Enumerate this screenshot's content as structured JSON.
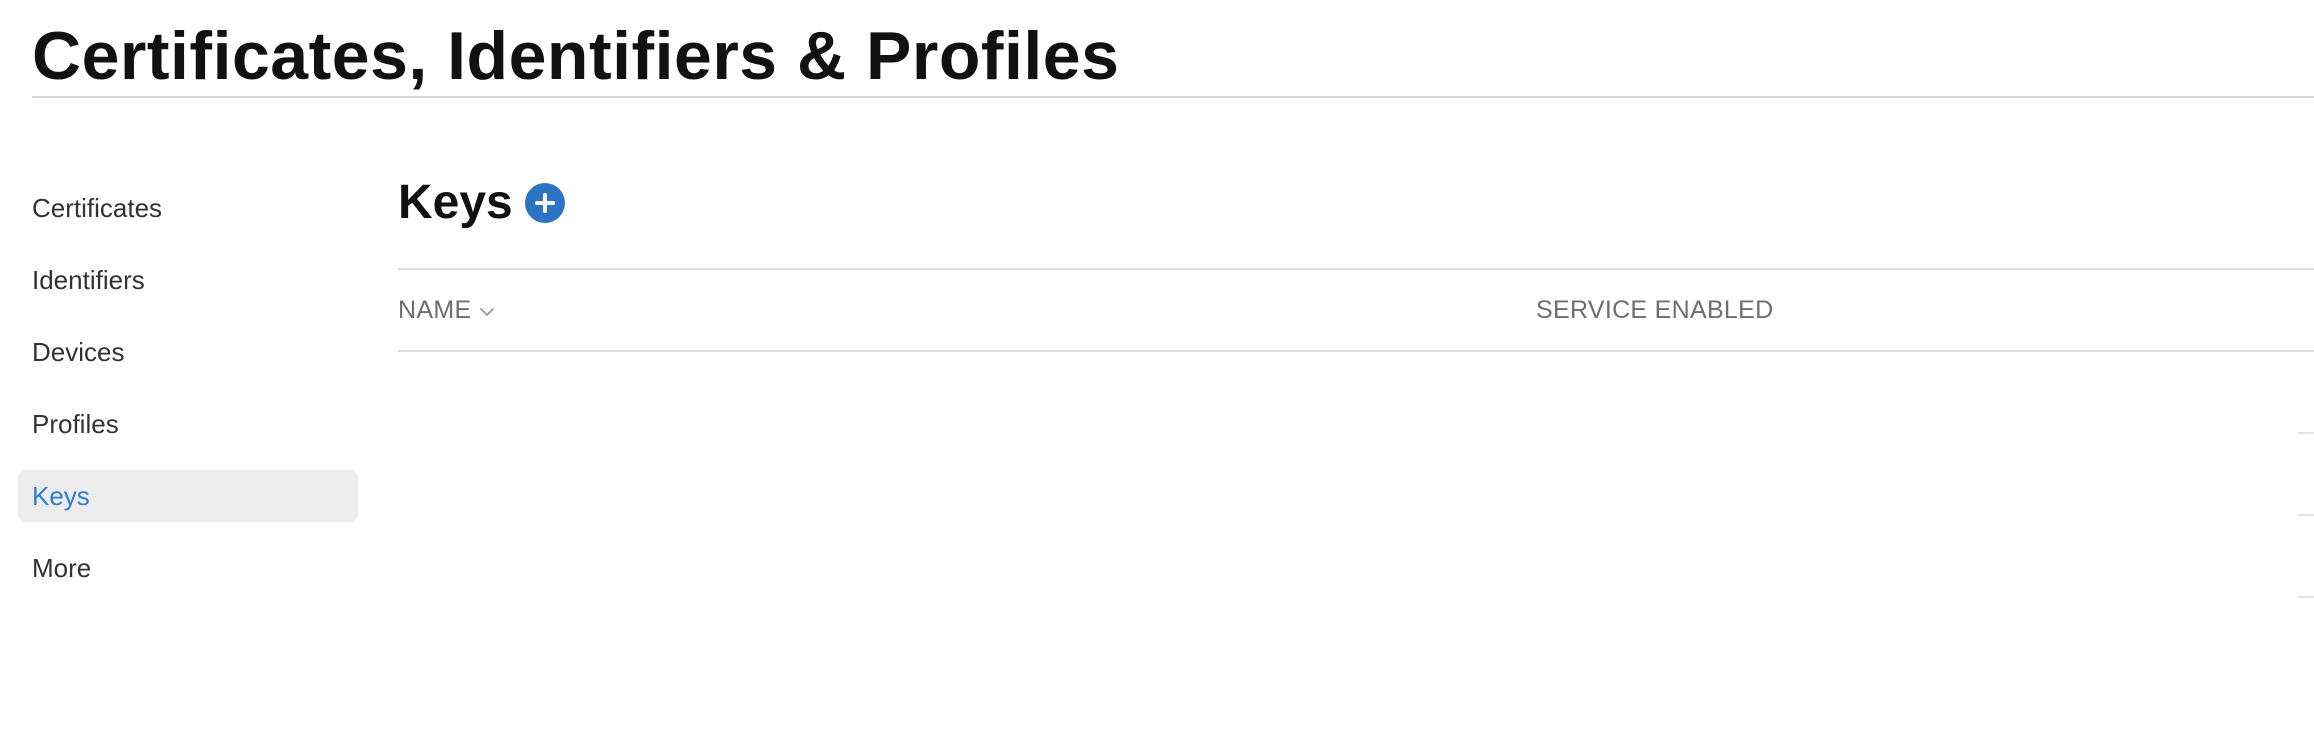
{
  "header": {
    "title": "Certificates, Identifiers & Profiles"
  },
  "sidebar": {
    "items": [
      {
        "label": "Certificates",
        "active": false
      },
      {
        "label": "Identifiers",
        "active": false
      },
      {
        "label": "Devices",
        "active": false
      },
      {
        "label": "Profiles",
        "active": false
      },
      {
        "label": "Keys",
        "active": true
      },
      {
        "label": "More",
        "active": false
      }
    ]
  },
  "main": {
    "section_title": "Keys",
    "add_icon": "plus-circle-icon",
    "table": {
      "columns": [
        {
          "label": "NAME",
          "sortable": true,
          "sort_icon": "chevron-down-icon"
        },
        {
          "label": "SERVICE ENABLED",
          "sortable": false
        }
      ],
      "rows": []
    }
  },
  "colors": {
    "accent": "#2f7dd6",
    "add_button": "#2d74c4",
    "active_item_bg": "#ececec",
    "divider": "#dcdcdc"
  }
}
